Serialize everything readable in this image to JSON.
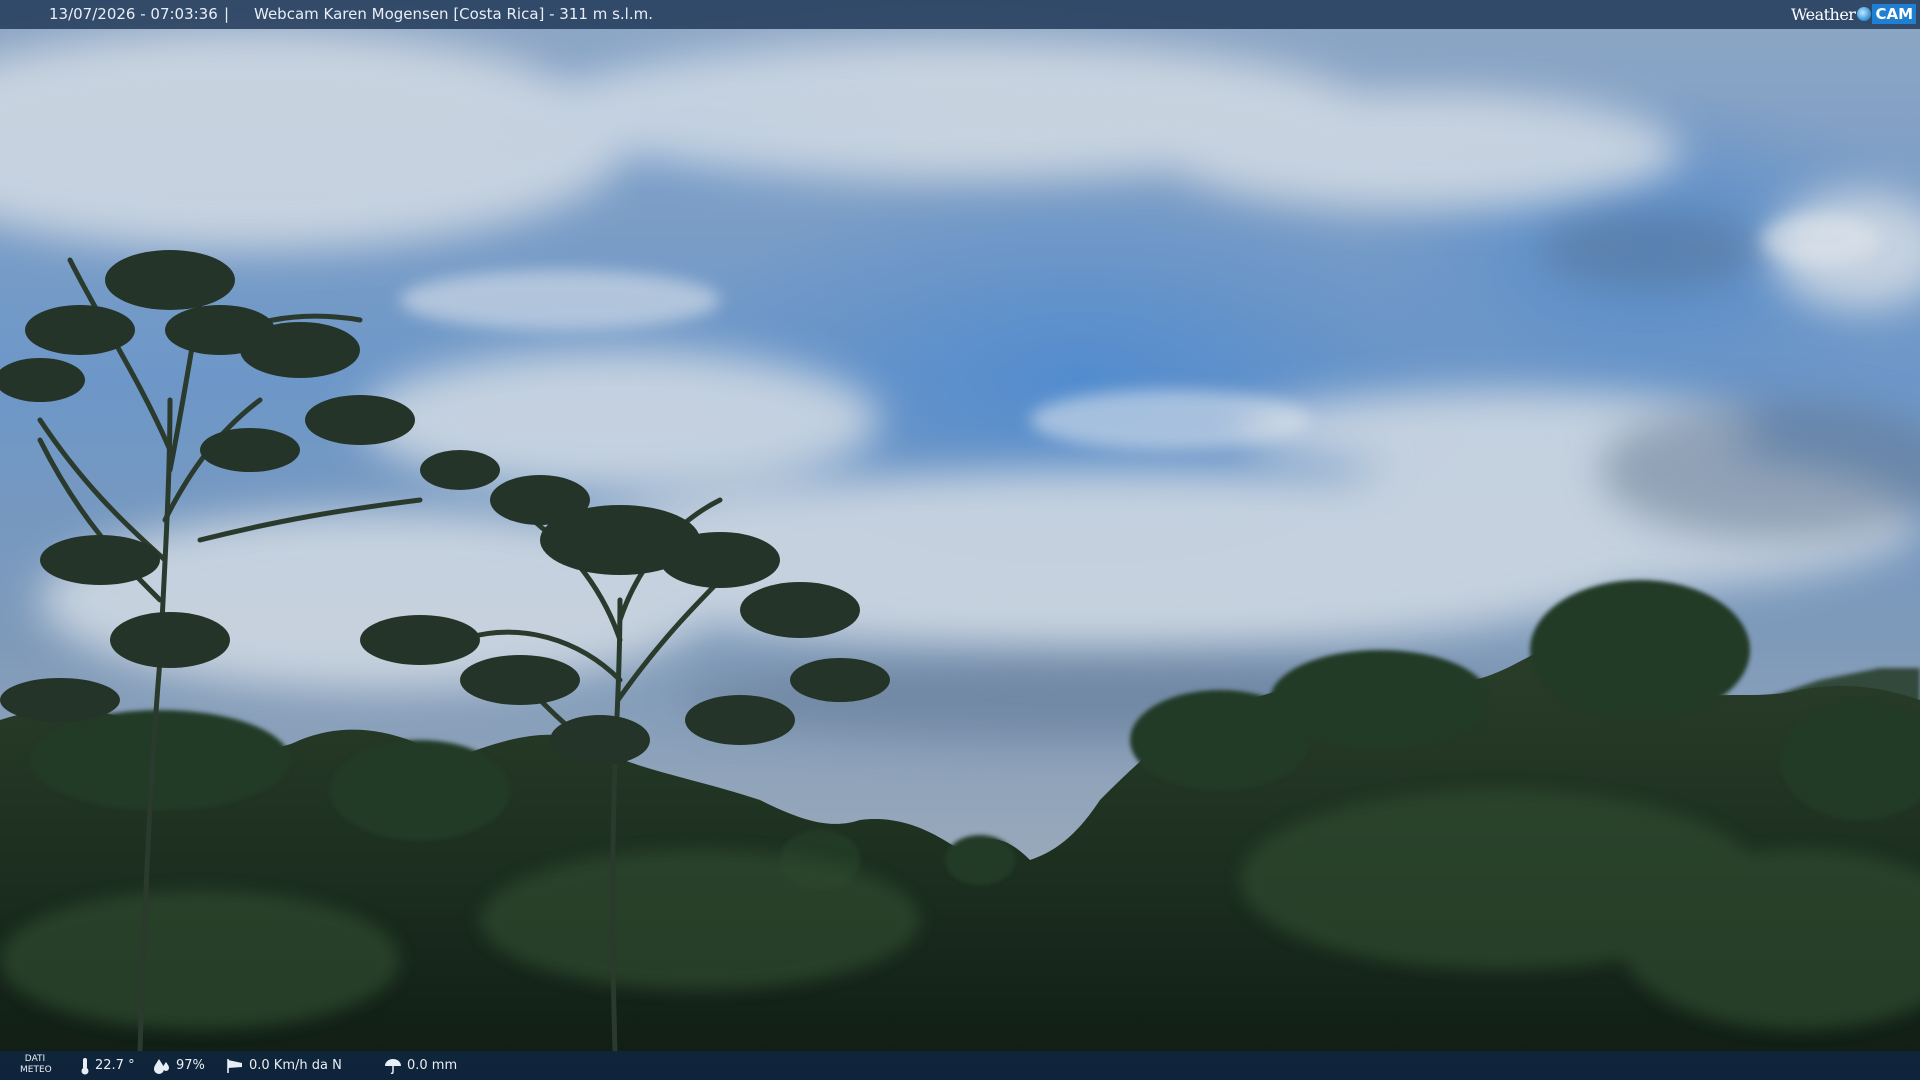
{
  "header": {
    "timestamp": "13/07/2026 - 07:03:36",
    "separator": "|",
    "title": "Webcam Karen Mogensen [Costa Rica] - 311 m s.l.m.",
    "logo_weather": "Weather",
    "logo_cam": "CAM"
  },
  "weather": {
    "section_label_1": "DATI",
    "section_label_2": "METEO",
    "temperature": "22.7 °",
    "humidity": "97%",
    "wind": "0.0 Km/h da N",
    "rain": "0.0 mm"
  },
  "icons": {
    "temperature": "thermometer-icon",
    "humidity": "droplet-icon",
    "wind": "windsock-icon",
    "rain": "umbrella-icon"
  },
  "colors": {
    "sky_top": "#8fa9c8",
    "sky_blue": "#4f86c4",
    "cloud": "#c9d3de",
    "forest": "#1c2e1f",
    "bar": "#263e5c"
  }
}
